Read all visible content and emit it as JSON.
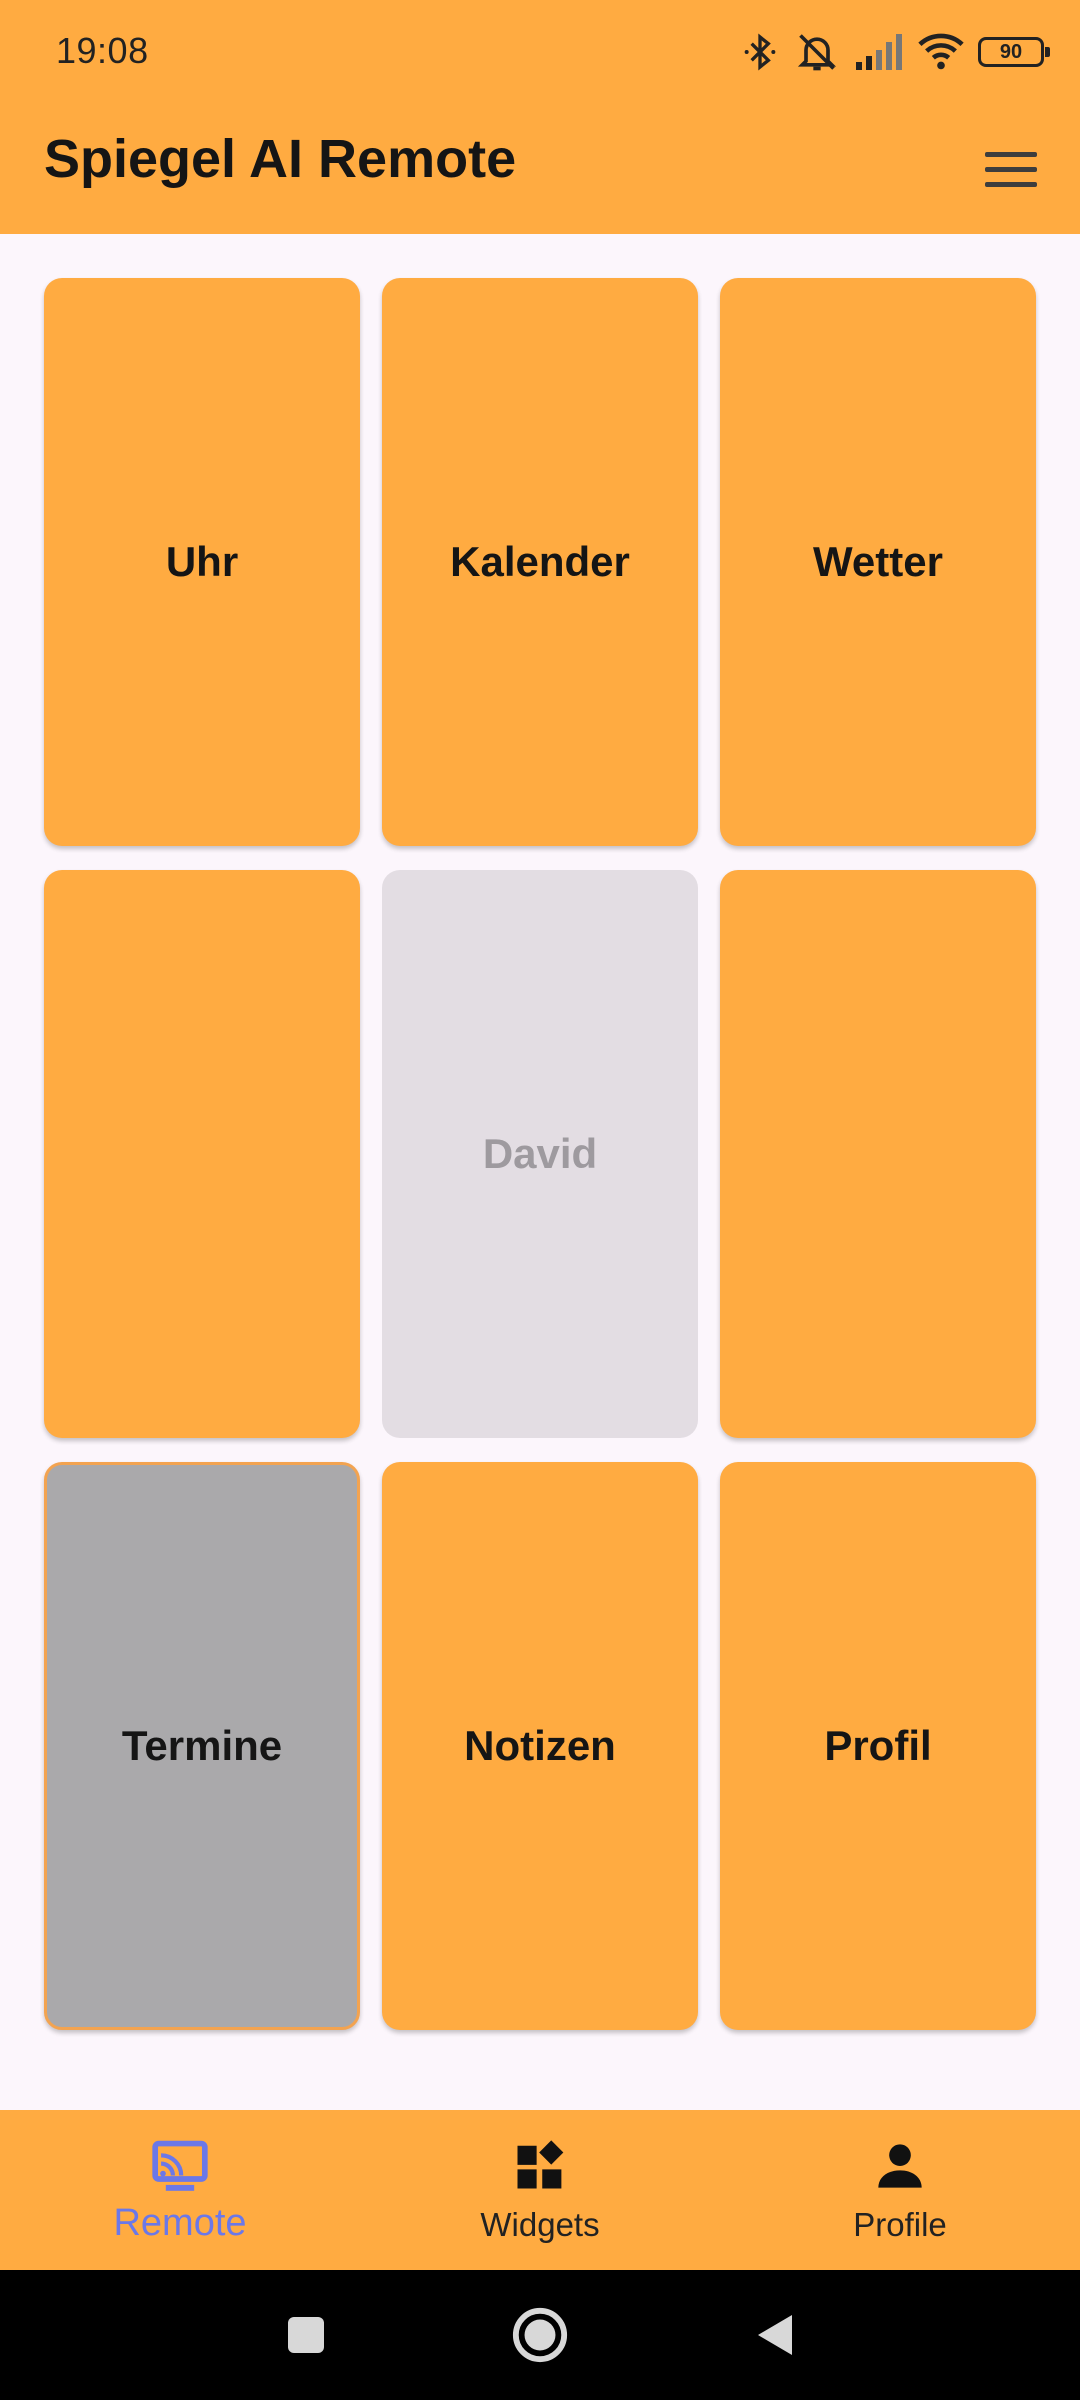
{
  "status_bar": {
    "time": "19:08",
    "battery": "90"
  },
  "app_bar": {
    "title": "Spiegel AI Remote"
  },
  "tiles": [
    {
      "label": "Uhr",
      "state": "normal"
    },
    {
      "label": "Kalender",
      "state": "normal"
    },
    {
      "label": "Wetter",
      "state": "normal"
    },
    {
      "label": "",
      "state": "normal"
    },
    {
      "label": "David",
      "state": "disabled"
    },
    {
      "label": "",
      "state": "normal"
    },
    {
      "label": "Termine",
      "state": "selected"
    },
    {
      "label": "Notizen",
      "state": "normal"
    },
    {
      "label": "Profil",
      "state": "normal"
    }
  ],
  "bottom_nav": {
    "items": [
      {
        "label": "Remote",
        "icon": "cast-icon",
        "active": true
      },
      {
        "label": "Widgets",
        "icon": "widgets-icon",
        "active": false
      },
      {
        "label": "Profile",
        "icon": "person-icon",
        "active": false
      }
    ]
  },
  "colors": {
    "accent": "#ffab41",
    "background": "#fcf6fc",
    "active_nav": "#6b78e8",
    "disabled_tile": "#e3dde3",
    "selected_tile": "#aaa9ab"
  }
}
